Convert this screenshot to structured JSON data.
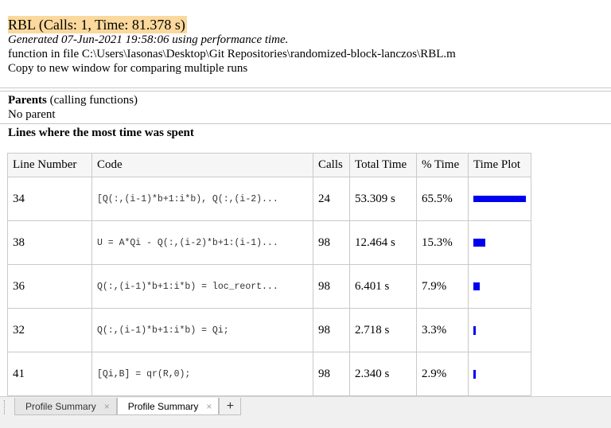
{
  "header": {
    "title": "RBL (Calls: 1, Time: 81.378 s)",
    "generated": "Generated 07-Jun-2021 19:58:06 using performance time.",
    "function_file": "function in file C:\\Users\\Iasonas\\Desktop\\Git Repositories\\randomized-block-lanczos\\RBL.m",
    "copy_text": "Copy to new window for comparing multiple runs"
  },
  "parents": {
    "label": "Parents",
    "sublabel": "(calling functions)",
    "value": "No parent"
  },
  "lines_section_title": "Lines where the most time was spent",
  "table": {
    "headers": [
      "Line Number",
      "Code",
      "Calls",
      "Total Time",
      "% Time",
      "Time Plot"
    ],
    "rows": [
      {
        "line": "34",
        "code": "[Q(:,(i-1)*b+1:i*b), Q(:,(i-2)...",
        "calls": "24",
        "total": "53.309 s",
        "pct": "65.5%",
        "plot_fraction": 1.0
      },
      {
        "line": "38",
        "code": "U = A*Qi - Q(:,(i-2)*b+1:(i-1)...",
        "calls": "98",
        "total": "12.464 s",
        "pct": "15.3%",
        "plot_fraction": 0.234
      },
      {
        "line": "36",
        "code": "Q(:,(i-1)*b+1:i*b) = loc_reort...",
        "calls": "98",
        "total": "6.401 s",
        "pct": "7.9%",
        "plot_fraction": 0.12
      },
      {
        "line": "32",
        "code": "Q(:,(i-1)*b+1:i*b) = Qi;",
        "calls": "98",
        "total": "2.718 s",
        "pct": "3.3%",
        "plot_fraction": 0.05
      },
      {
        "line": "41",
        "code": "[Qi,B] = qr(R,0);",
        "calls": "98",
        "total": "2.340 s",
        "pct": "2.9%",
        "plot_fraction": 0.044
      }
    ]
  },
  "tabs": {
    "tab1": "Profile Summary",
    "tab2": "Profile Summary",
    "close_glyph": "×",
    "add_glyph": "+"
  },
  "colors": {
    "title_highlight": "#fbd89c",
    "bar": "#0000ee"
  }
}
